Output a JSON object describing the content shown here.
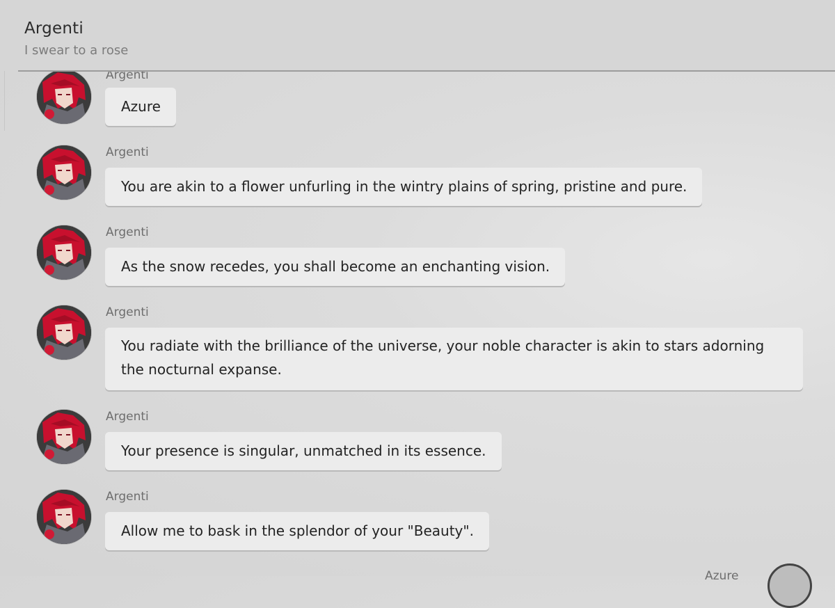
{
  "header": {
    "title": "Argenti",
    "subtitle": "I swear to a rose"
  },
  "messages": [
    {
      "sender": "Argenti",
      "text": "Azure"
    },
    {
      "sender": "Argenti",
      "text": "You are akin to a flower unfurling in the wintry plains of spring, pristine and pure."
    },
    {
      "sender": "Argenti",
      "text": "As the snow recedes, you shall become an enchanting vision."
    },
    {
      "sender": "Argenti",
      "text": "You radiate with the brilliance of the universe, your noble character is akin to stars adorning the nocturnal expanse."
    },
    {
      "sender": "Argenti",
      "text": "Your presence is singular, unmatched in its essence."
    },
    {
      "sender": "Argenti",
      "text": "Allow me to bask in the splendor of your \"Beauty\"."
    }
  ],
  "next_message": {
    "sender": "Azure"
  },
  "colors": {
    "bubble": "#ececec",
    "background": "#d9d9d9",
    "avatar_hair": "#c8102e"
  },
  "icons": {
    "contact_avatar": "argenti-avatar",
    "player_avatar": "azure-avatar"
  }
}
